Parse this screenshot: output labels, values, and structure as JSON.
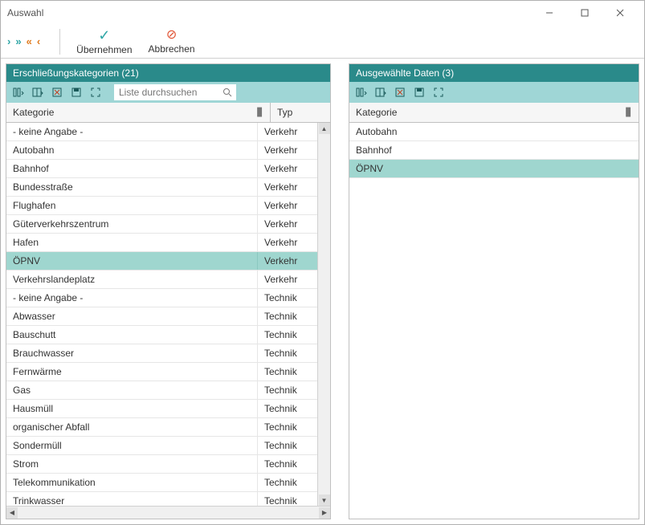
{
  "window": {
    "title": "Auswahl"
  },
  "toolbar": {
    "apply_label": "Übernehmen",
    "cancel_label": "Abbrechen"
  },
  "left": {
    "header": "Erschließungskategorien (21)",
    "search_placeholder": "Liste durchsuchen",
    "columns": {
      "kat": "Kategorie",
      "typ": "Typ"
    },
    "rows": [
      {
        "kat": "- keine Angabe -",
        "typ": "Verkehr",
        "sel": false
      },
      {
        "kat": "Autobahn",
        "typ": "Verkehr",
        "sel": false
      },
      {
        "kat": "Bahnhof",
        "typ": "Verkehr",
        "sel": false
      },
      {
        "kat": "Bundesstraße",
        "typ": "Verkehr",
        "sel": false
      },
      {
        "kat": "Flughafen",
        "typ": "Verkehr",
        "sel": false
      },
      {
        "kat": "Güterverkehrszentrum",
        "typ": "Verkehr",
        "sel": false
      },
      {
        "kat": "Hafen",
        "typ": "Verkehr",
        "sel": false
      },
      {
        "kat": "ÖPNV",
        "typ": "Verkehr",
        "sel": true
      },
      {
        "kat": "Verkehrslandeplatz",
        "typ": "Verkehr",
        "sel": false
      },
      {
        "kat": "- keine Angabe -",
        "typ": "Technik",
        "sel": false
      },
      {
        "kat": "Abwasser",
        "typ": "Technik",
        "sel": false
      },
      {
        "kat": "Bauschutt",
        "typ": "Technik",
        "sel": false
      },
      {
        "kat": "Brauchwasser",
        "typ": "Technik",
        "sel": false
      },
      {
        "kat": "Fernwärme",
        "typ": "Technik",
        "sel": false
      },
      {
        "kat": "Gas",
        "typ": "Technik",
        "sel": false
      },
      {
        "kat": "Hausmüll",
        "typ": "Technik",
        "sel": false
      },
      {
        "kat": "organischer Abfall",
        "typ": "Technik",
        "sel": false
      },
      {
        "kat": "Sondermüll",
        "typ": "Technik",
        "sel": false
      },
      {
        "kat": "Strom",
        "typ": "Technik",
        "sel": false
      },
      {
        "kat": "Telekommunikation",
        "typ": "Technik",
        "sel": false
      },
      {
        "kat": "Trinkwasser",
        "typ": "Technik",
        "sel": false
      }
    ]
  },
  "right": {
    "header": "Ausgewählte Daten (3)",
    "columns": {
      "kat": "Kategorie"
    },
    "rows": [
      {
        "kat": "Autobahn",
        "sel": false
      },
      {
        "kat": "Bahnhof",
        "sel": false
      },
      {
        "kat": "ÖPNV",
        "sel": true
      }
    ]
  }
}
